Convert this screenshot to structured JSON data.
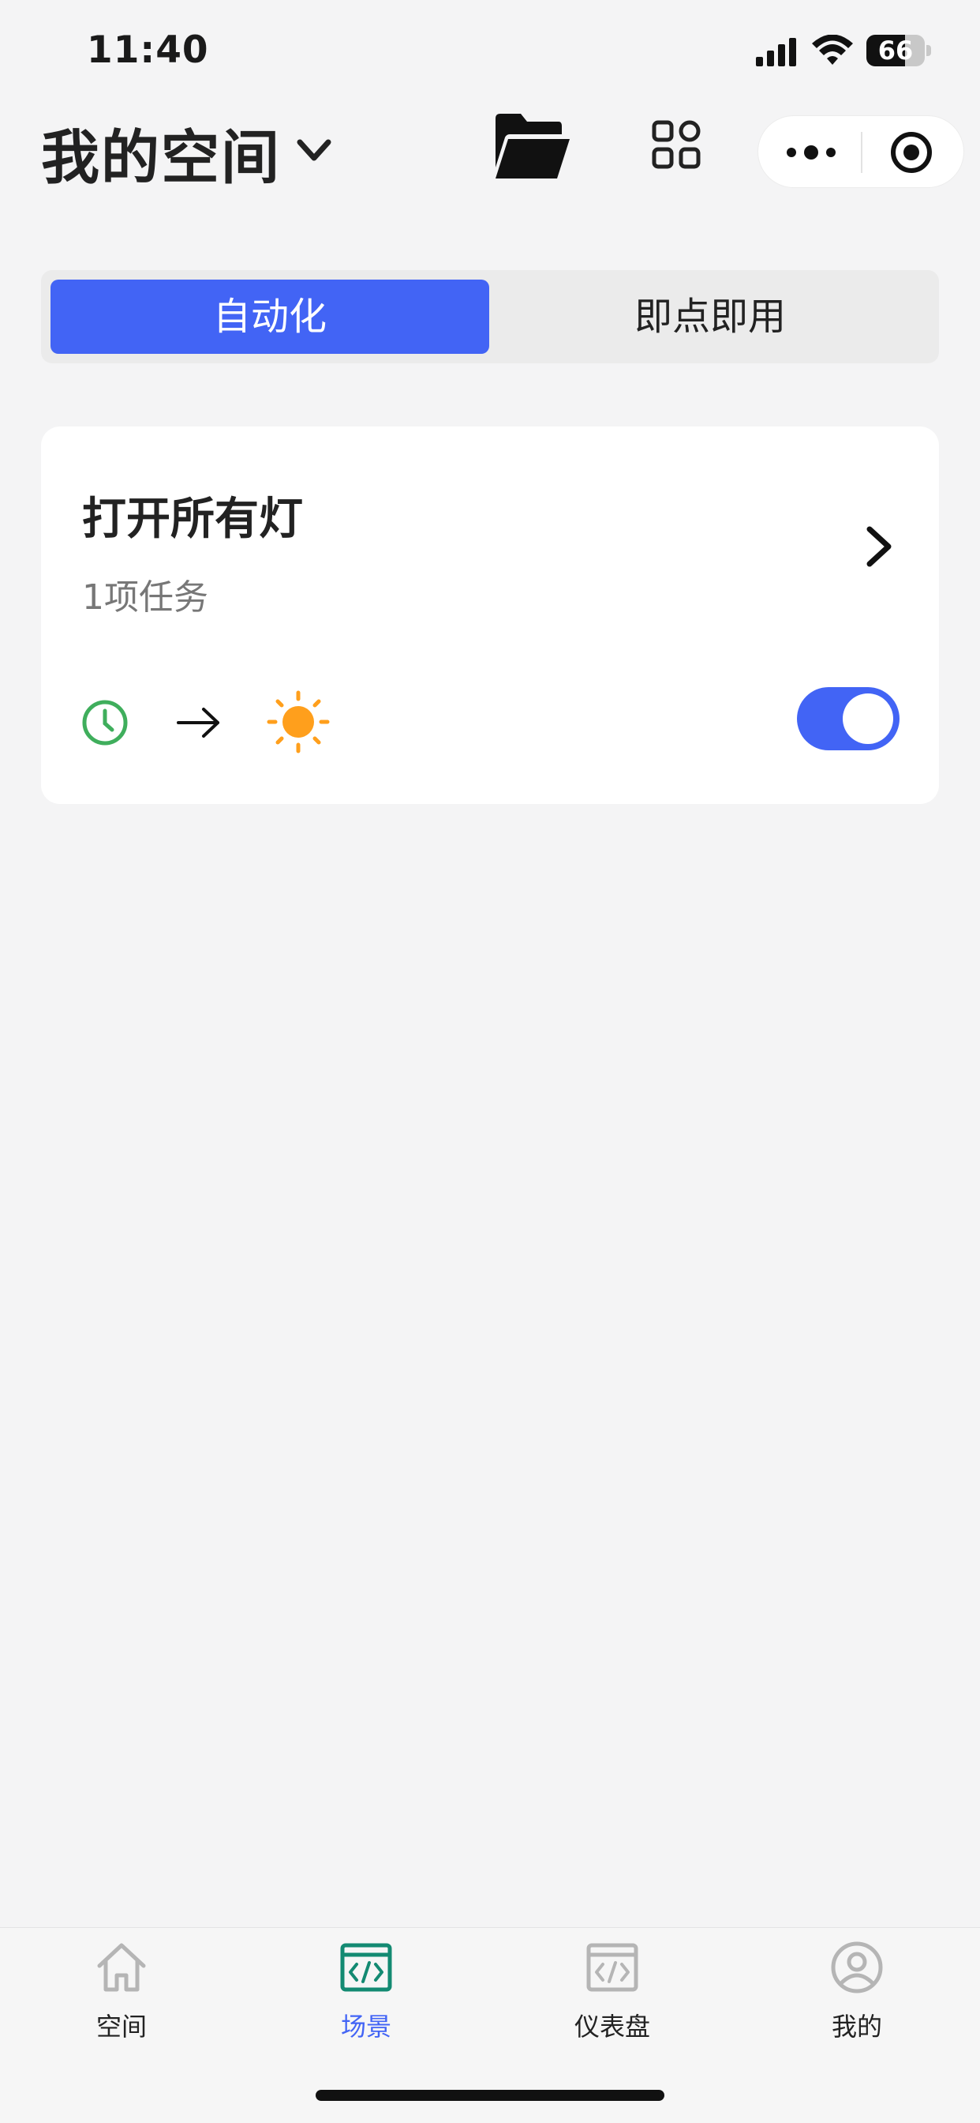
{
  "status_bar": {
    "time": "11:40",
    "battery_level": "66",
    "battery_fraction": 0.66
  },
  "header": {
    "title": "我的空间",
    "icons": [
      "chevron-down-icon",
      "folder-icon",
      "grid-icon",
      "more-icon",
      "target-icon"
    ]
  },
  "segment": {
    "tabs": [
      {
        "label": "自动化",
        "active": true
      },
      {
        "label": "即点即用",
        "active": false
      }
    ]
  },
  "scene_card": {
    "title": "打开所有灯",
    "subtitle": "1项任务",
    "trigger_icon": "clock-icon",
    "action_icon": "sun-icon",
    "enabled": true
  },
  "tab_bar": {
    "items": [
      {
        "label": "空间",
        "icon": "home-icon",
        "active": false
      },
      {
        "label": "场景",
        "icon": "scene-icon",
        "active": true
      },
      {
        "label": "仪表盘",
        "icon": "dashboard-icon",
        "active": false
      },
      {
        "label": "我的",
        "icon": "profile-icon",
        "active": false
      }
    ]
  },
  "colors": {
    "accent": "#4264f5",
    "background": "#f4f4f5",
    "clock_green": "#3fae5c",
    "sun_orange": "#ff9f1c",
    "scene_tab_teal": "#138a72",
    "tab_gray": "#b5b5b5"
  }
}
